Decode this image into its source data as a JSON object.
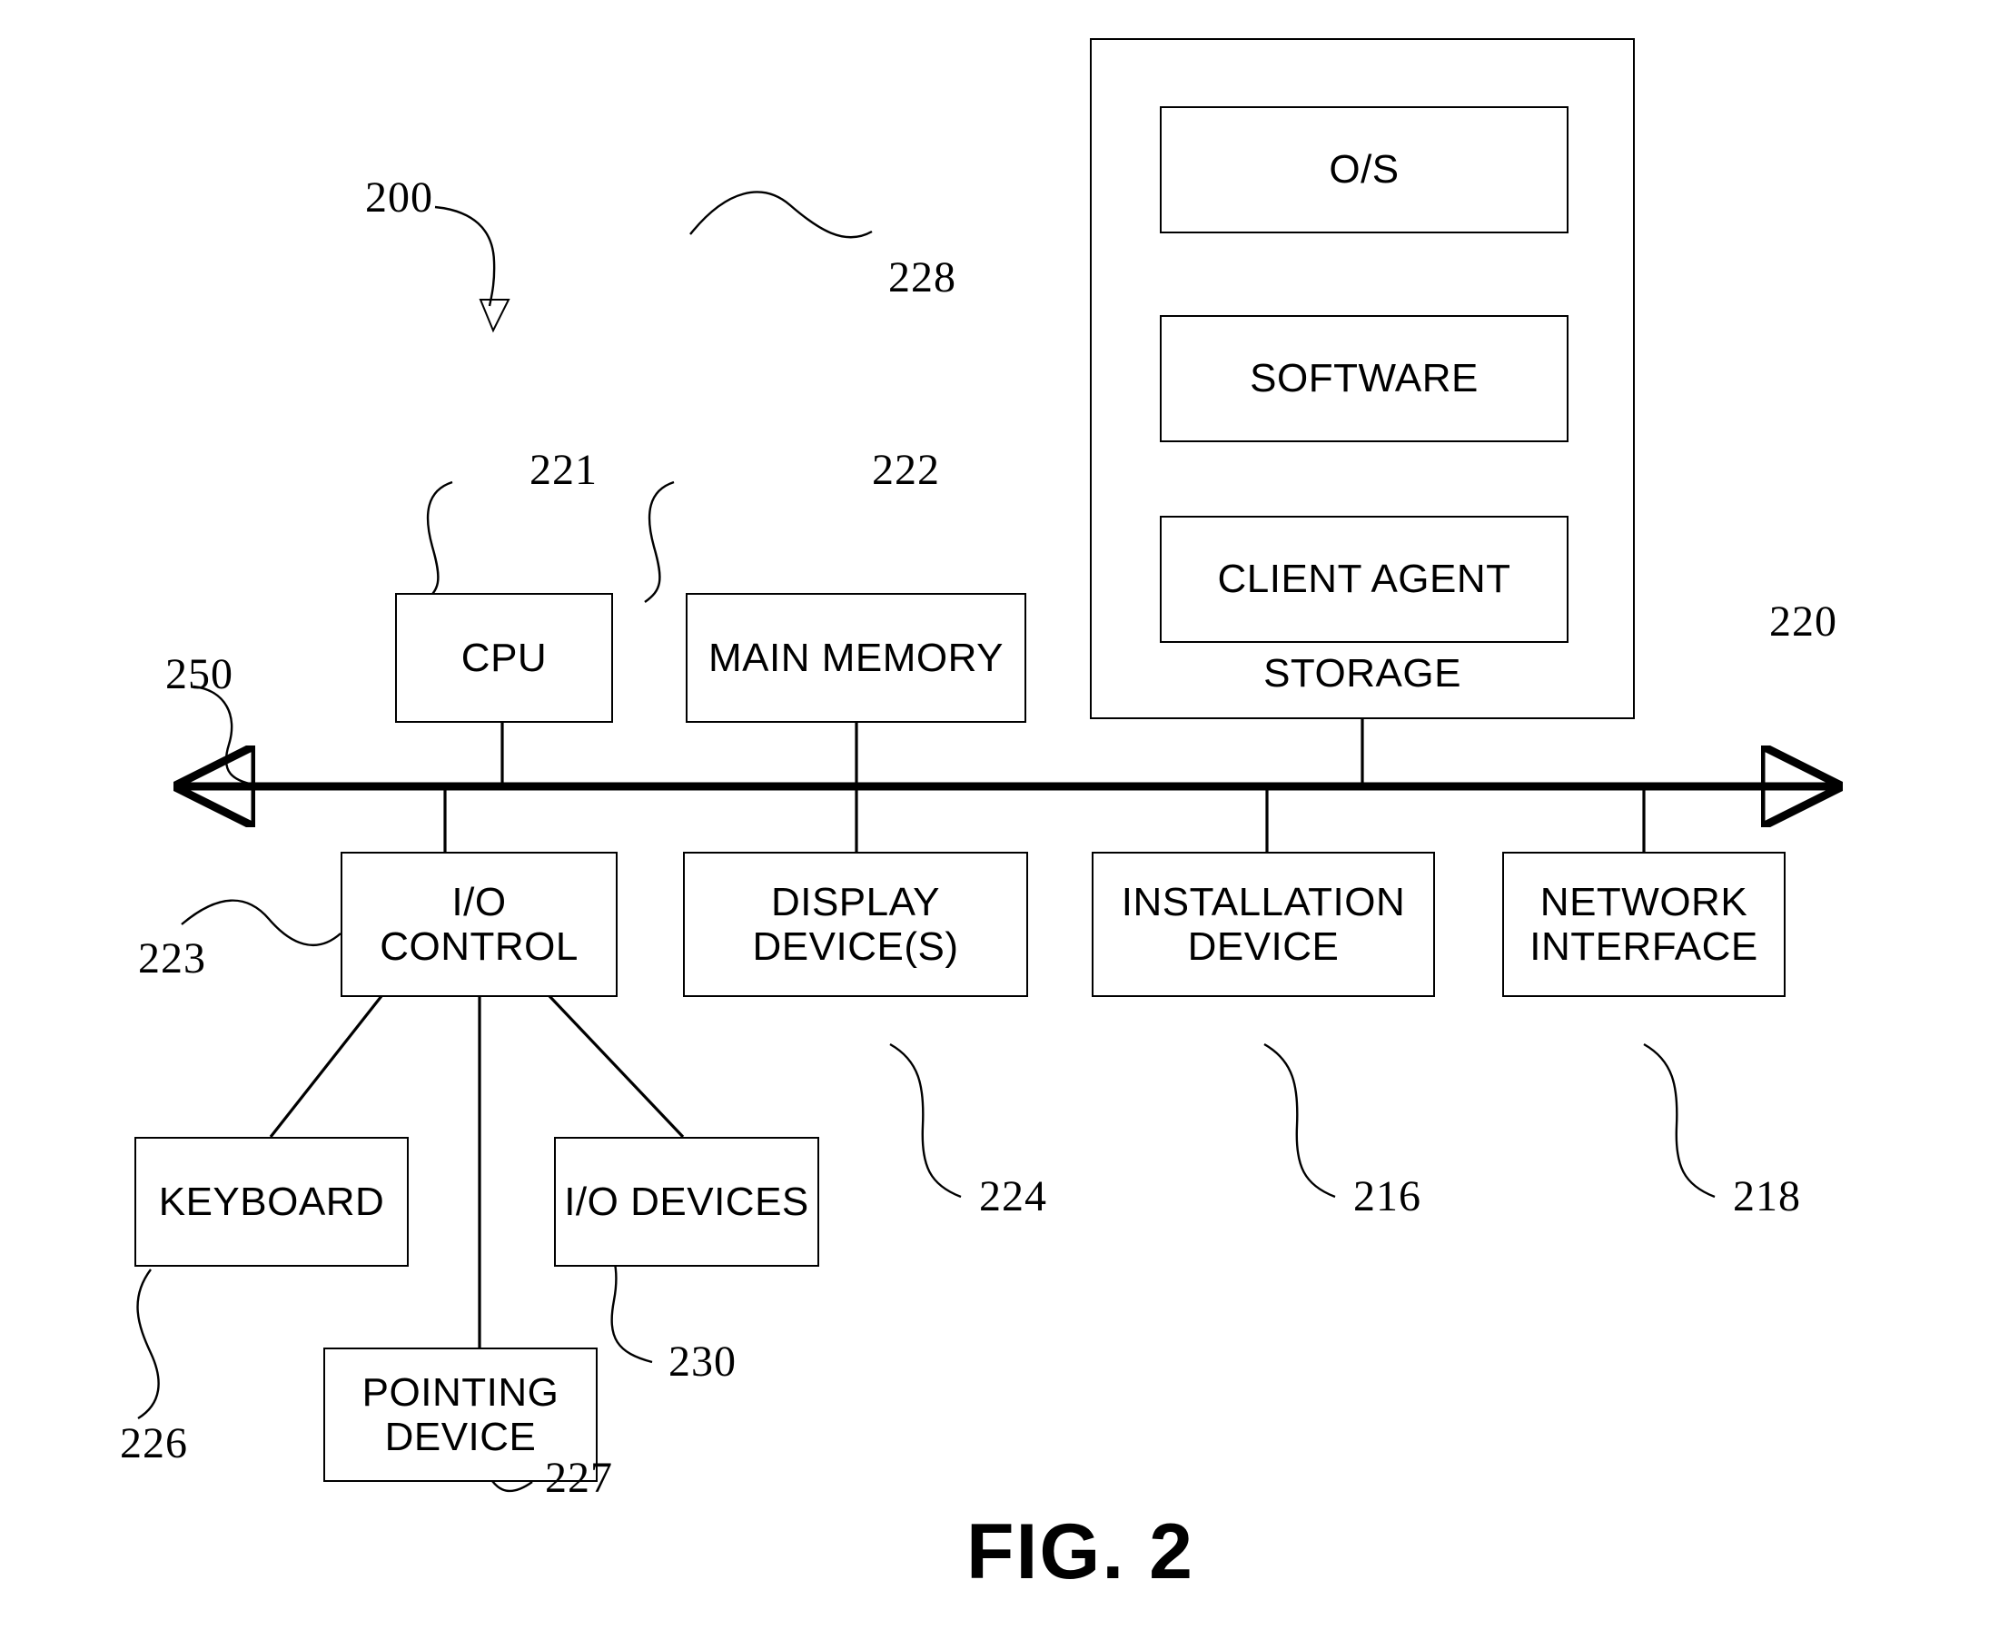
{
  "figure": {
    "caption": "FIG. 2",
    "system_ref": "200"
  },
  "bus": {
    "ref": "250",
    "name": "system bus"
  },
  "storage": {
    "ref": "220",
    "label": "STORAGE",
    "inner_ref": "228",
    "items": [
      {
        "label": "O/S"
      },
      {
        "label": "SOFTWARE"
      },
      {
        "label": "CLIENT AGENT"
      }
    ]
  },
  "top_row": [
    {
      "label": "CPU",
      "ref": "221"
    },
    {
      "label": "MAIN MEMORY",
      "ref": "222"
    }
  ],
  "bottom_row": [
    {
      "label": "I/O CONTROL",
      "ref": "223"
    },
    {
      "label_line1": "DISPLAY",
      "label_line2": "DEVICE(S)",
      "ref": "224"
    },
    {
      "label_line1": "INSTALLATION",
      "label_line2": "DEVICE",
      "ref": "216"
    },
    {
      "label_line1": "NETWORK",
      "label_line2": "INTERFACE",
      "ref": "218"
    }
  ],
  "peripherals": [
    {
      "label": "KEYBOARD",
      "ref": "226"
    },
    {
      "label": "I/O DEVICES",
      "ref": "230"
    },
    {
      "label_line1": "POINTING",
      "label_line2": "DEVICE",
      "ref": "227"
    }
  ],
  "colors": {
    "ink": "#000000",
    "paper": "#ffffff"
  }
}
